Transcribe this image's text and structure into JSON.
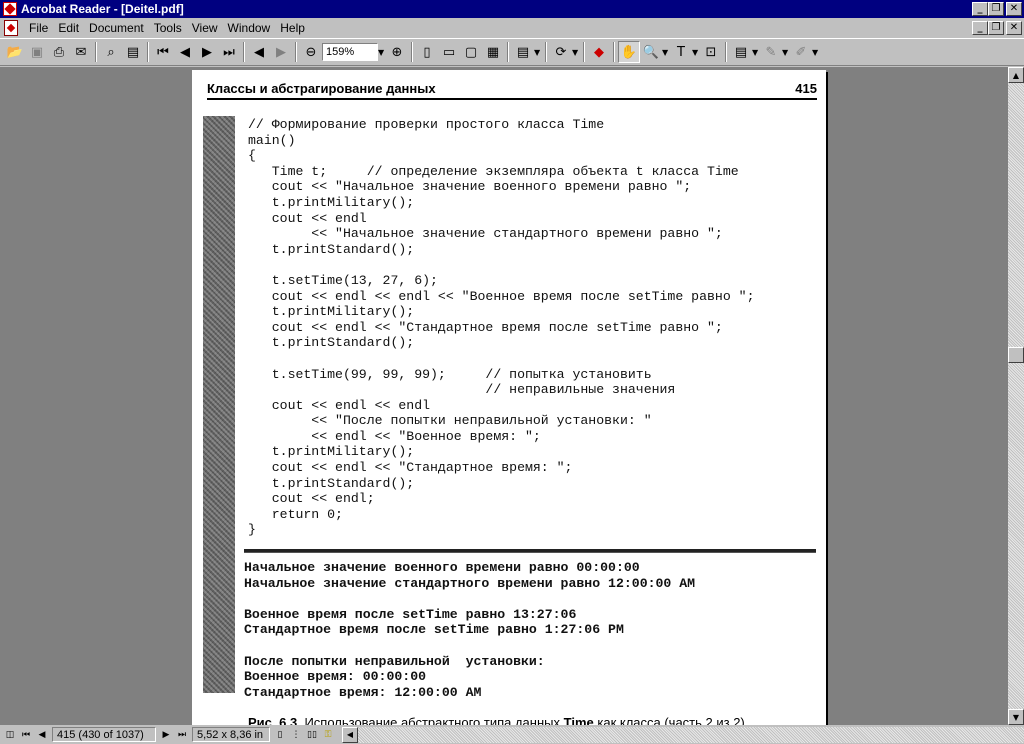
{
  "window": {
    "title": "Acrobat Reader - [Deitel.pdf]"
  },
  "menu": {
    "items": [
      {
        "label": "File"
      },
      {
        "label": "Edit"
      },
      {
        "label": "Document"
      },
      {
        "label": "Tools"
      },
      {
        "label": "View"
      },
      {
        "label": "Window"
      },
      {
        "label": "Help"
      }
    ]
  },
  "toolbar": {
    "zoom_value": "159%"
  },
  "page": {
    "header_title": "Классы и абстрагирование данных",
    "page_number": "415",
    "code_lines": [
      "// Формирование проверки простого класса Time",
      "main()",
      "{",
      "   Time t;     // определение экземпляра объекта t класса Time",
      "   cout << \"Начальное значение военного времени равно \";",
      "   t.printMilitary();",
      "   cout << endl",
      "        << \"Начальное значение стандартного времени равно \";",
      "   t.printStandard();",
      "",
      "   t.setTime(13, 27, 6);",
      "   cout << endl << endl << \"Военное время после setTime равно \";",
      "   t.printMilitary();",
      "   cout << endl << \"Стандартное время после setTime равно \";",
      "   t.printStandard();",
      "",
      "   t.setTime(99, 99, 99);     // попытка установить",
      "                              // неправильные значения",
      "   cout << endl << endl",
      "        << \"После попытки неправильной установки: \"",
      "        << endl << \"Военное время: \";",
      "   t.printMilitary();",
      "   cout << endl << \"Стандартное время: \";",
      "   t.printStandard();",
      "   cout << endl;",
      "   return 0;",
      "}"
    ],
    "output_lines": [
      "Начальное значение военного времени равно 00:00:00",
      "Начальное значение стандартного времени равно 12:00:00 AM",
      "",
      "Военное время после setTime равно 13:27:06",
      "Стандартное время после setTime равно 1:27:06 PM",
      "",
      "После попытки неправильной  установки:",
      "Военное время: 00:00:00",
      "Стандартное время: 12:00:00 AM"
    ],
    "caption": {
      "label": "Рис. 6.3.",
      "text_before": "Использование абстрактного типа данных",
      "bold_word": "Time",
      "text_after": "как класса (часть 2 из 2)"
    }
  },
  "statusbar": {
    "page_indicator": "415  (430 of 1037)",
    "page_size": "5,52 x 8,36 in"
  }
}
